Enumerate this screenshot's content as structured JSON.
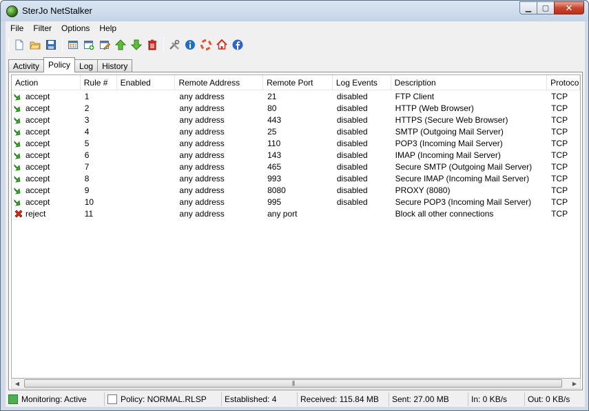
{
  "window": {
    "title": "SterJo NetStalker",
    "controls": {
      "minimize": "▁",
      "maximize": "▢",
      "close": "✕"
    }
  },
  "menu": [
    "File",
    "Filter",
    "Options",
    "Help"
  ],
  "toolbar_icons": [
    "new-file-icon",
    "open-folder-icon",
    "save-icon",
    "rules-grid-icon",
    "add-rule-icon",
    "edit-rule-icon",
    "move-up-icon",
    "move-down-icon",
    "delete-icon",
    "tools-icon",
    "info-icon",
    "help-lifebuoy-icon",
    "home-icon",
    "facebook-icon"
  ],
  "tabs": [
    "Activity",
    "Policy",
    "Log",
    "History"
  ],
  "active_tab": "Policy",
  "table": {
    "columns": [
      "Action",
      "Rule #",
      "Enabled",
      "Remote Address",
      "Remote Port",
      "Log Events",
      "Description",
      "Protocol"
    ],
    "rows": [
      {
        "action": "accept",
        "rule": "1",
        "enabled": "",
        "address": "any address",
        "port": "21",
        "log": "disabled",
        "description": "FTP Client",
        "protocol": "TCP"
      },
      {
        "action": "accept",
        "rule": "2",
        "enabled": "",
        "address": "any address",
        "port": "80",
        "log": "disabled",
        "description": "HTTP (Web Browser)",
        "protocol": "TCP"
      },
      {
        "action": "accept",
        "rule": "3",
        "enabled": "",
        "address": "any address",
        "port": "443",
        "log": "disabled",
        "description": "HTTPS (Secure Web Browser)",
        "protocol": "TCP"
      },
      {
        "action": "accept",
        "rule": "4",
        "enabled": "",
        "address": "any address",
        "port": "25",
        "log": "disabled",
        "description": "SMTP (Outgoing Mail Server)",
        "protocol": "TCP"
      },
      {
        "action": "accept",
        "rule": "5",
        "enabled": "",
        "address": "any address",
        "port": "110",
        "log": "disabled",
        "description": "POP3 (Incoming Mail Server)",
        "protocol": "TCP"
      },
      {
        "action": "accept",
        "rule": "6",
        "enabled": "",
        "address": "any address",
        "port": "143",
        "log": "disabled",
        "description": "IMAP (Incoming Mail Server)",
        "protocol": "TCP"
      },
      {
        "action": "accept",
        "rule": "7",
        "enabled": "",
        "address": "any address",
        "port": "465",
        "log": "disabled",
        "description": "Secure SMTP (Outgoing Mail Server)",
        "protocol": "TCP"
      },
      {
        "action": "accept",
        "rule": "8",
        "enabled": "",
        "address": "any address",
        "port": "993",
        "log": "disabled",
        "description": "Secure IMAP (Incoming Mail Server)",
        "protocol": "TCP"
      },
      {
        "action": "accept",
        "rule": "9",
        "enabled": "",
        "address": "any address",
        "port": "8080",
        "log": "disabled",
        "description": "PROXY (8080)",
        "protocol": "TCP"
      },
      {
        "action": "accept",
        "rule": "10",
        "enabled": "",
        "address": "any address",
        "port": "995",
        "log": "disabled",
        "description": "Secure POP3 (Incoming Mail Server)",
        "protocol": "TCP"
      },
      {
        "action": "reject",
        "rule": "11",
        "enabled": "",
        "address": "any address",
        "port": "any port",
        "log": "",
        "description": "Block all other connections",
        "protocol": "TCP"
      }
    ]
  },
  "scrollbar": {
    "left_arrow": "◀",
    "right_arrow": "▶",
    "grip": "|||"
  },
  "status": {
    "monitoring": "Monitoring: Active",
    "policy": "Policy: NORMAL.RLSP",
    "established": "Established: 4",
    "received": "Received: 115.84 MB",
    "sent": "Sent: 27.00 MB",
    "in": "In: 0 KB/s",
    "out": "Out: 0 KB/s"
  },
  "colors": {
    "accept_green": "#3aa82a",
    "reject_red": "#d8281a",
    "monitoring_box": "#4caf50"
  }
}
